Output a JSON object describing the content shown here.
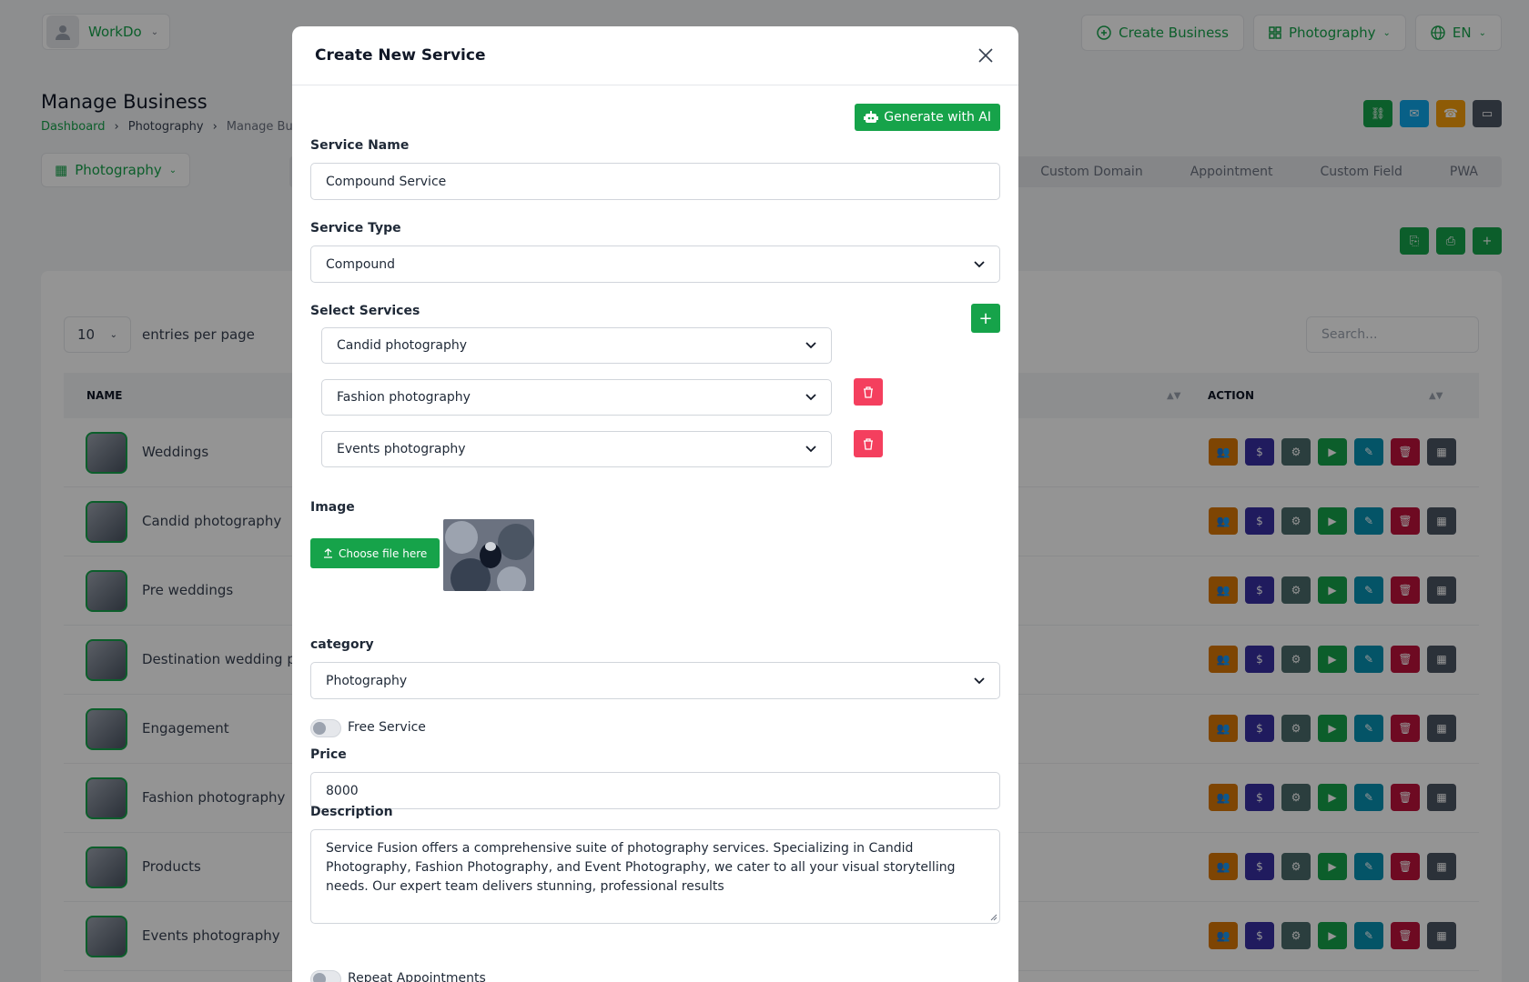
{
  "topbar": {
    "user_name": "WorkDo",
    "create_business": "Create Business",
    "business": "Photography",
    "language": "EN"
  },
  "page": {
    "title": "Manage Business",
    "breadcrumb": [
      "Dashboard",
      "Photography",
      "Manage Bus"
    ],
    "business_select": "Photography",
    "tabs": [
      "Custom Domain",
      "Appointment",
      "Custom Field",
      "PWA"
    ]
  },
  "table": {
    "entries_value": "10",
    "entries_label": "entries per page",
    "search_placeholder": "Search...",
    "col_name": "NAME",
    "col_action": "ACTION",
    "rows": [
      "Weddings",
      "Candid photography",
      "Pre weddings",
      "Destination wedding pho",
      "Engagement",
      "Fashion photography",
      "Products",
      "Events photography"
    ]
  },
  "modal": {
    "title": "Create New Service",
    "ai_button": "Generate with AI",
    "service_name_label": "Service Name",
    "service_name_value": "Compound Service",
    "service_type_label": "Service Type",
    "service_type_value": "Compound",
    "select_services_label": "Select Services",
    "selected_services": [
      "Candid photography",
      "Fashion photography",
      "Events photography"
    ],
    "image_label": "Image",
    "choose_file": "Choose file here",
    "category_label": "category",
    "category_value": "Photography",
    "free_service_label": "Free Service",
    "price_label": "Price",
    "price_value": "8000",
    "description_label": "Description",
    "description_value": "Service Fusion offers a comprehensive suite of photography services. Specializing in Candid Photography, Fashion Photography, and Event Photography, we cater to all your visual storytelling needs. Our expert team delivers stunning, professional results",
    "repeat_label": "Repeat Appointments"
  },
  "colors": {
    "primary": "#16a34a",
    "danger": "#f43f5e",
    "orange": "#d97706",
    "indigo": "#3730a3",
    "slate": "#4b6b6b",
    "teal": "#0891b2",
    "crimson": "#be123c",
    "dark": "#4b5563"
  }
}
